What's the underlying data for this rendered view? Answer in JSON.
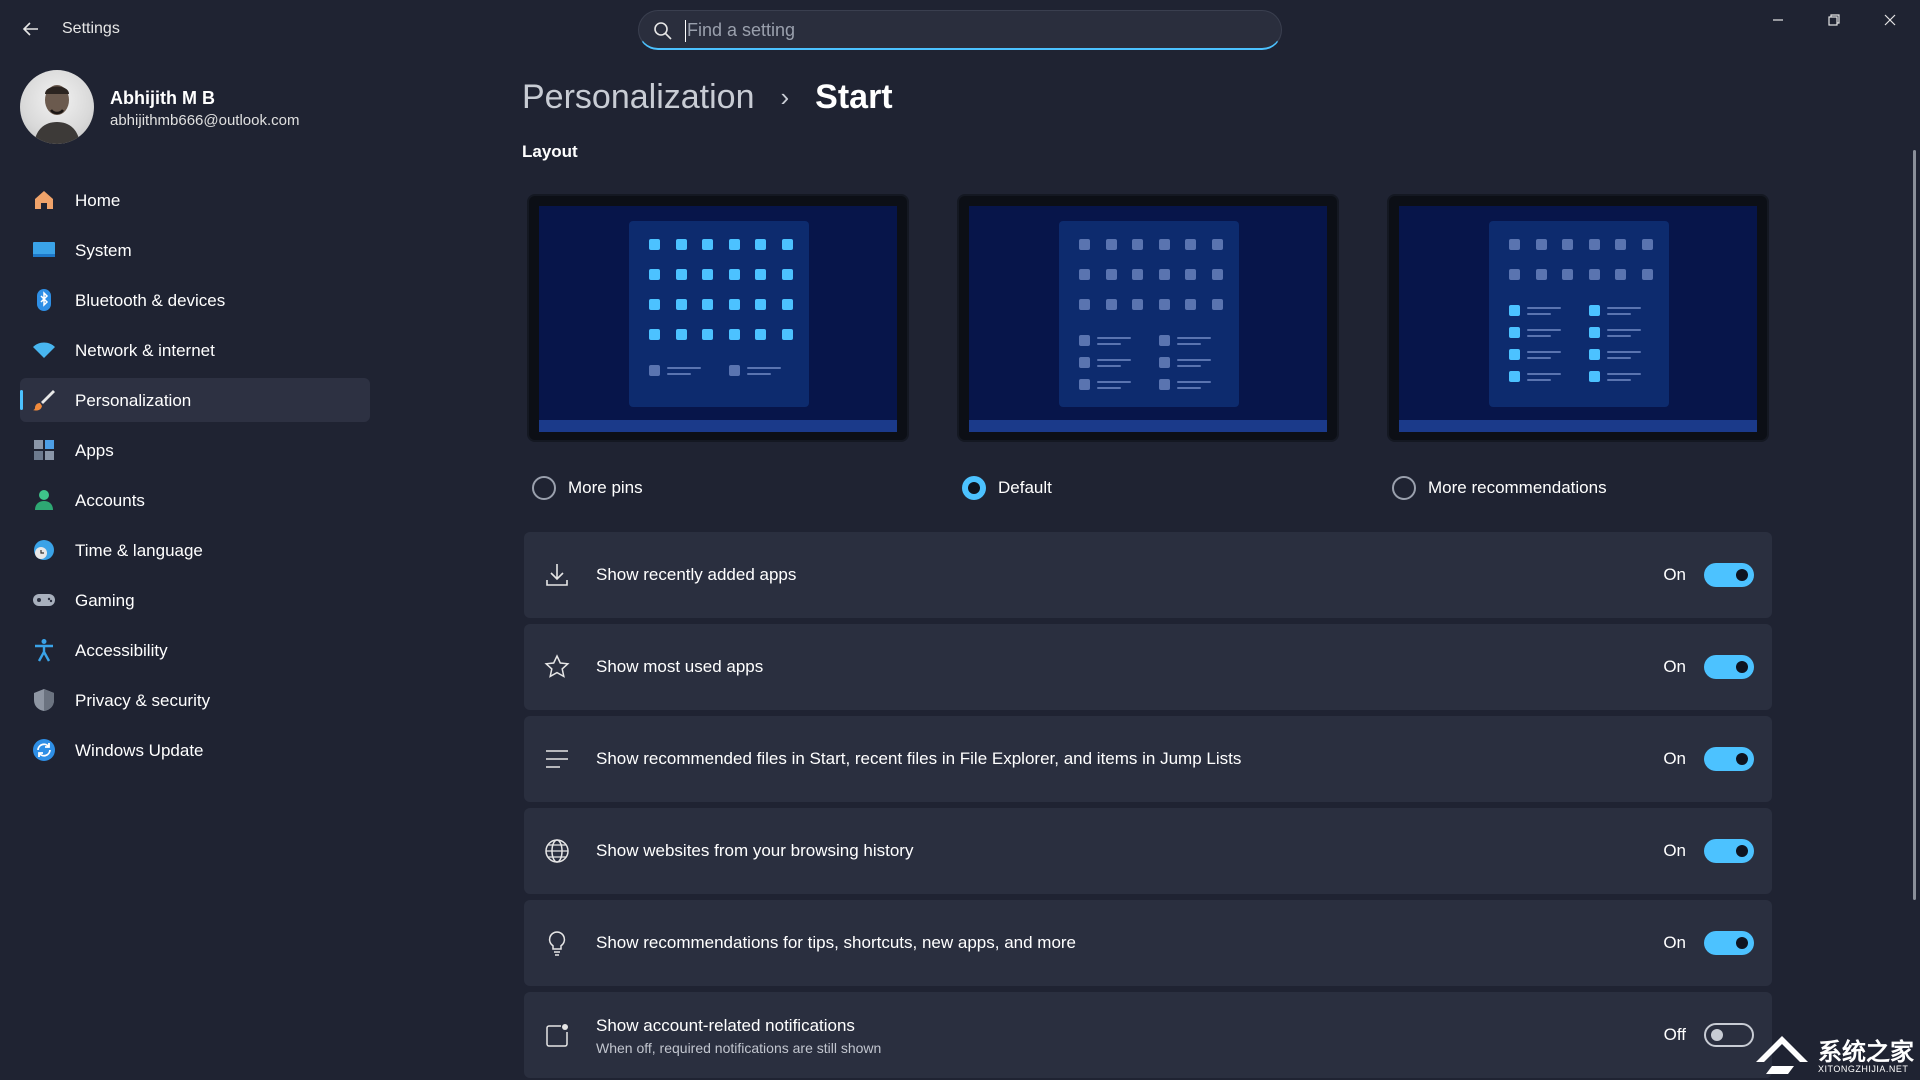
{
  "app": {
    "title": "Settings"
  },
  "search": {
    "placeholder": "Find a setting",
    "value": ""
  },
  "profile": {
    "name": "Abhijith M B",
    "email": "abhijithmb666@outlook.com"
  },
  "sidebar": {
    "items": [
      {
        "label": "Home",
        "icon": "home-icon",
        "active": false
      },
      {
        "label": "System",
        "icon": "system-icon",
        "active": false
      },
      {
        "label": "Bluetooth & devices",
        "icon": "bluetooth-icon",
        "active": false
      },
      {
        "label": "Network & internet",
        "icon": "wifi-icon",
        "active": false
      },
      {
        "label": "Personalization",
        "icon": "brush-icon",
        "active": true
      },
      {
        "label": "Apps",
        "icon": "apps-icon",
        "active": false
      },
      {
        "label": "Accounts",
        "icon": "accounts-icon",
        "active": false
      },
      {
        "label": "Time & language",
        "icon": "clock-globe-icon",
        "active": false
      },
      {
        "label": "Gaming",
        "icon": "gamepad-icon",
        "active": false
      },
      {
        "label": "Accessibility",
        "icon": "accessibility-icon",
        "active": false
      },
      {
        "label": "Privacy & security",
        "icon": "shield-icon",
        "active": false
      },
      {
        "label": "Windows Update",
        "icon": "update-icon",
        "active": false
      }
    ]
  },
  "breadcrumb": {
    "parent": "Personalization",
    "separator": "›",
    "current": "Start"
  },
  "layout": {
    "title": "Layout",
    "options": [
      {
        "label": "More pins",
        "selected": false
      },
      {
        "label": "Default",
        "selected": true
      },
      {
        "label": "More recommendations",
        "selected": false
      }
    ]
  },
  "settings": [
    {
      "label": "Show recently added apps",
      "state": "On",
      "on": true,
      "icon": "download-icon"
    },
    {
      "label": "Show most used apps",
      "state": "On",
      "on": true,
      "icon": "star-icon"
    },
    {
      "label": "Show recommended files in Start, recent files in File Explorer, and items in Jump Lists",
      "state": "On",
      "on": true,
      "icon": "list-icon"
    },
    {
      "label": "Show websites from your browsing history",
      "state": "On",
      "on": true,
      "icon": "globe-icon"
    },
    {
      "label": "Show recommendations for tips, shortcuts, new apps, and more",
      "state": "On",
      "on": true,
      "icon": "lightbulb-icon"
    },
    {
      "label": "Show account-related notifications",
      "sublabel": "When off, required notifications are still shown",
      "state": "Off",
      "on": false,
      "icon": "notification-icon"
    }
  ],
  "watermark": {
    "text": "系统之家",
    "url": "XITONGZHIJIA.NET"
  },
  "colors": {
    "accent": "#4cc2ff",
    "background": "#1f2332",
    "card": "#2a2f3f"
  }
}
